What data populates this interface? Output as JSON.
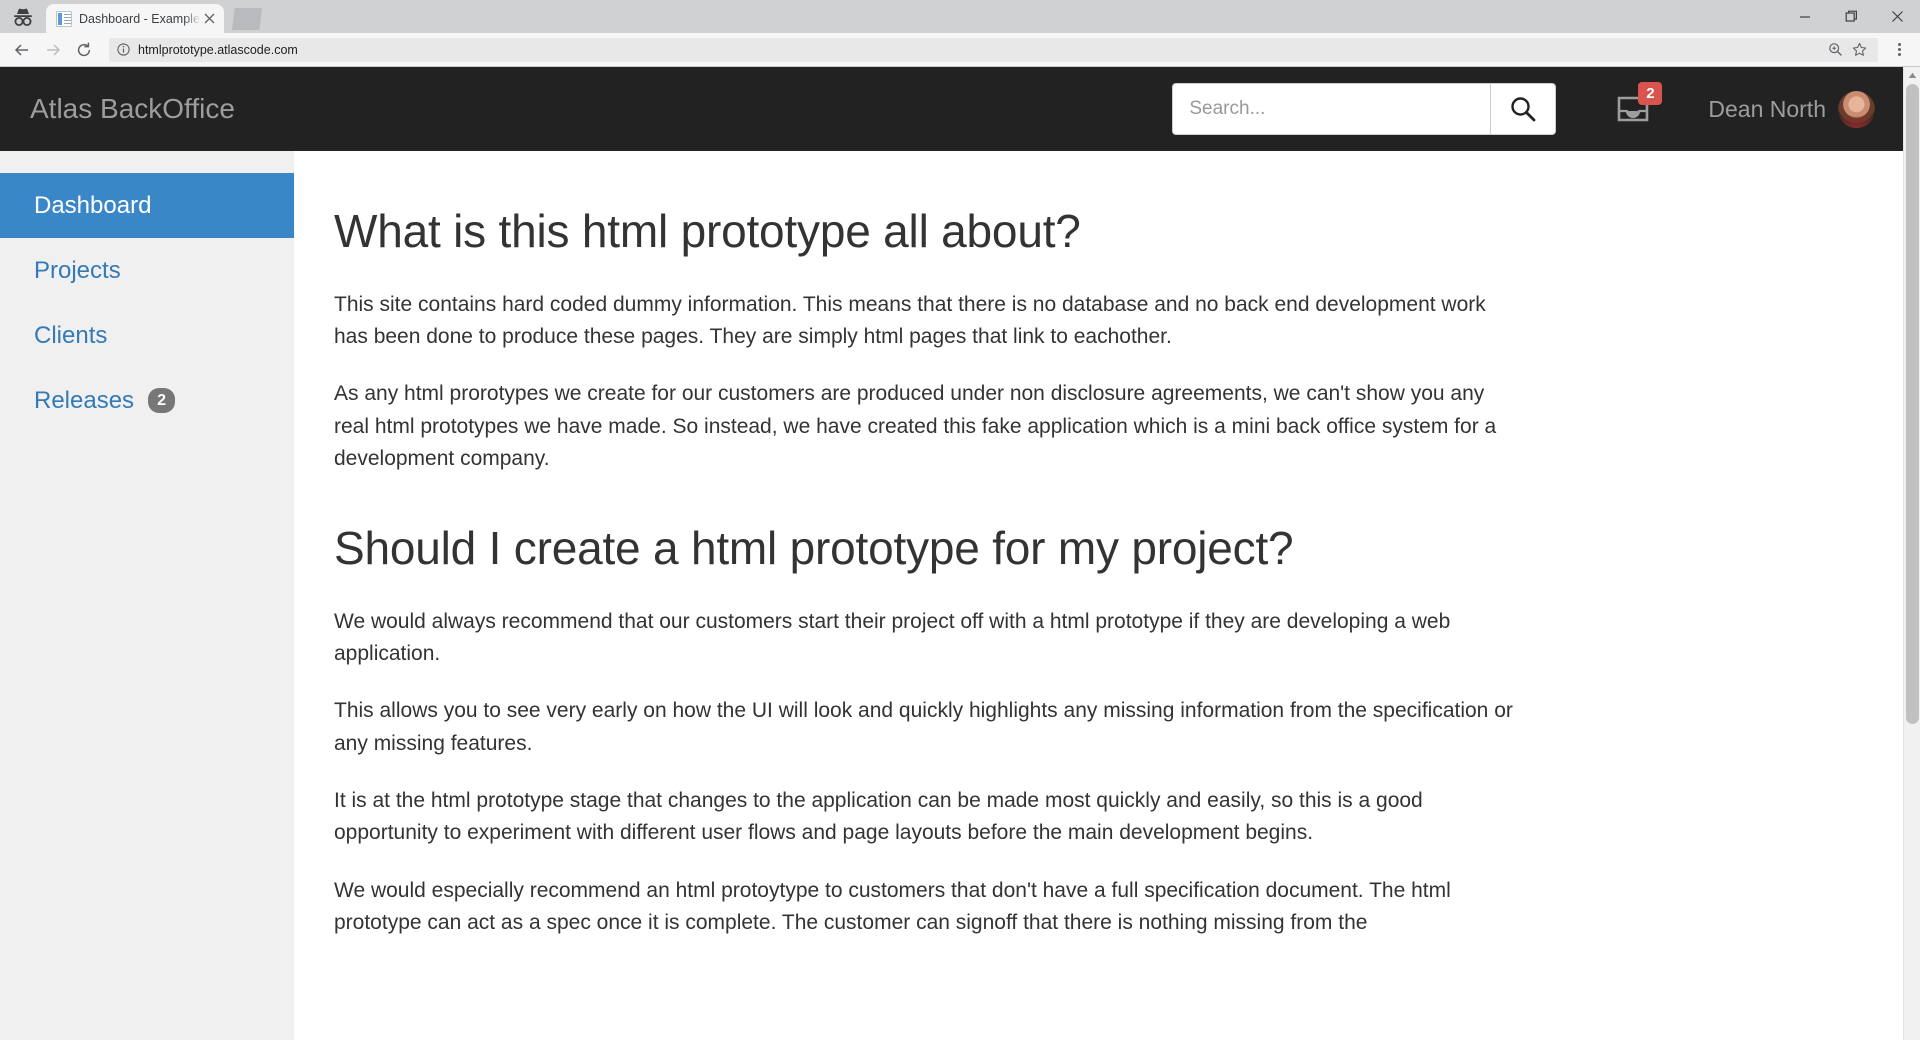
{
  "browser": {
    "incognito_icon": "incognito-icon",
    "tab": {
      "title": "Dashboard - ExampleHtm",
      "favicon_icon": "page-favicon-icon",
      "close_icon": "close-icon"
    },
    "new_tab_label": "",
    "window_controls": {
      "minimize": "minimize-icon",
      "maximize": "maximize-icon",
      "close": "close-icon"
    },
    "toolbar": {
      "back_icon": "back-arrow-icon",
      "forward_icon": "forward-arrow-icon",
      "reload_icon": "reload-icon",
      "info_icon": "site-info-icon",
      "url": "htmlprototype.atlascode.com",
      "zoom_icon": "zoom-icon",
      "bookmark_icon": "star-icon",
      "menu_icon": "three-dots-menu-icon"
    }
  },
  "app": {
    "brand": "Atlas BackOffice",
    "search": {
      "placeholder": "Search...",
      "value": "",
      "button_icon": "search-icon"
    },
    "inbox": {
      "icon": "inbox-icon",
      "count": "2"
    },
    "user": {
      "name": "Dean North",
      "avatar_icon": "avatar"
    },
    "header_bg": "#222222",
    "accent": "#337ab7"
  },
  "sidebar": {
    "items": [
      {
        "label": "Dashboard",
        "active": true,
        "badge": ""
      },
      {
        "label": "Projects",
        "active": false,
        "badge": ""
      },
      {
        "label": "Clients",
        "active": false,
        "badge": ""
      },
      {
        "label": "Releases",
        "active": false,
        "badge": "2"
      }
    ]
  },
  "main": {
    "heading1": "What is this html prototype all about?",
    "p1": "This site contains hard coded dummy information. This means that there is no database and no back end development work has been done to produce these pages. They are simply html pages that link to eachother.",
    "p2": "As any html prorotypes we create for our customers are produced under non disclosure agreements, we can't show you any real html prototypes we have made. So instead, we have created this fake application which is a mini back office system for a development company.",
    "heading2": "Should I create a html prototype for my project?",
    "p3": "We would always recommend that our customers start their project off with a html prototype if they are developing a web application.",
    "p4": "This allows you to see very early on how the UI will look and quickly highlights any missing information from the specification or any missing features.",
    "p5": "It is at the html prototype stage that changes to the application can be made most quickly and easily, so this is a good opportunity to experiment with different user flows and page layouts before the main development begins.",
    "p6": "We would especially recommend an html protoytype to customers that don't have a full specification document. The html prototype can act as a spec once it is complete. The customer can signoff that there is nothing missing from the"
  },
  "scrollbar": {
    "up_arrow_icon": "scroll-up-arrow-icon"
  }
}
